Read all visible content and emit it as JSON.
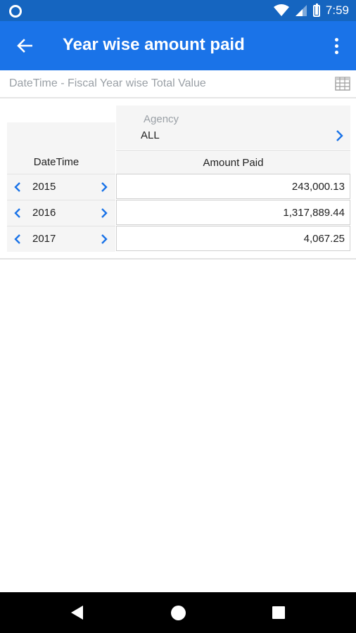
{
  "status_bar": {
    "time": "7:59",
    "left_icon": "ring-icon",
    "right_icons": [
      "wifi-icon",
      "signal-icon",
      "battery-icon"
    ]
  },
  "app_bar": {
    "title": "Year wise amount paid",
    "back_icon": "arrow-left-icon",
    "menu_icon": "more-vertical-icon",
    "color": "#1a73e8"
  },
  "report": {
    "title": "DateTime - Fiscal Year wise Total Value",
    "view_icon": "grid-table-icon"
  },
  "pivot": {
    "filter": {
      "label": "Agency",
      "value": "ALL"
    },
    "row_header": "DateTime",
    "column_header": "Amount Paid",
    "rows": [
      {
        "year": "2015",
        "amount": "243,000.13"
      },
      {
        "year": "2016",
        "amount": "1,317,889.44"
      },
      {
        "year": "2017",
        "amount": "4,067.25"
      }
    ],
    "accent_color": "#1a73e8"
  },
  "nav_bar": {
    "icons": [
      "nav-back-icon",
      "nav-home-icon",
      "nav-recents-icon"
    ]
  }
}
